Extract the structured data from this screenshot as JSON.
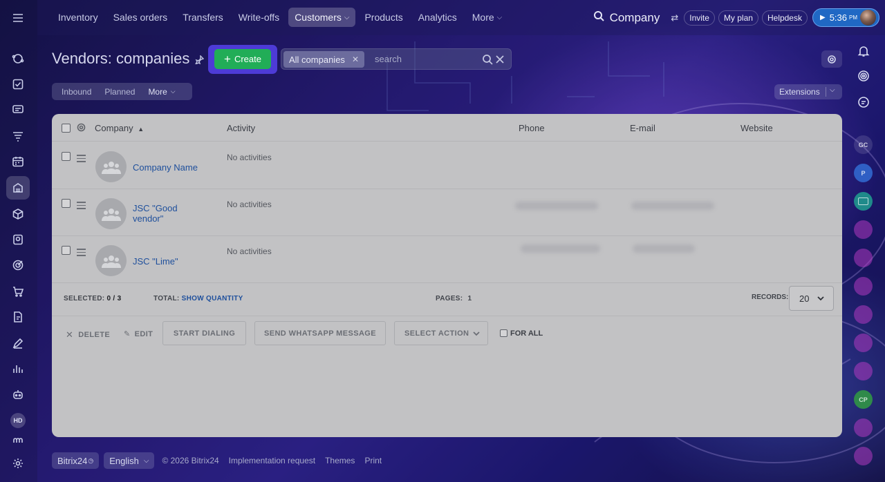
{
  "topnav": {
    "items": [
      "Inventory",
      "Sales orders",
      "Transfers",
      "Write-offs",
      "Customers",
      "Products",
      "Analytics",
      "More"
    ],
    "active": "Customers"
  },
  "top_right": {
    "title": "Company",
    "invite": "Invite",
    "my_plan": "My plan",
    "helpdesk": "Helpdesk",
    "time": "5:36",
    "ampm": "PM"
  },
  "page": {
    "title": "Vendors: companies",
    "create_label": "Create"
  },
  "filter": {
    "tag": "All companies",
    "placeholder": "search"
  },
  "subtabs": [
    "Inbound",
    "Planned",
    "More"
  ],
  "extensions_label": "Extensions",
  "grid": {
    "columns": [
      "Company",
      "Activity",
      "Phone",
      "E-mail",
      "Website"
    ],
    "rows": [
      {
        "name": "Company Name",
        "activity": "No activities"
      },
      {
        "name": "JSC \"Good vendor\"",
        "activity": "No activities"
      },
      {
        "name": "JSC \"Lime\"",
        "activity": "No activities"
      }
    ]
  },
  "summary": {
    "selected_label": "SELECTED:",
    "selected_value": "0 / 3",
    "total_label": "TOTAL:",
    "total_link": "SHOW QUANTITY",
    "pages_label": "PAGES:",
    "pages_value": "1",
    "records_label": "RECORDS:",
    "records_value": "20"
  },
  "actions": {
    "delete": "DELETE",
    "edit": "EDIT",
    "start_dialing": "START DIALING",
    "send_whatsapp": "SEND WHATSAPP MESSAGE",
    "select_action": "SELECT ACTION",
    "for_all": "FOR ALL"
  },
  "right_rail": {
    "avatars": [
      "GC",
      "P",
      "",
      "",
      "",
      "",
      "",
      "",
      "",
      "CP",
      "",
      ""
    ]
  },
  "sidebar": {
    "hd_badge": "HD"
  },
  "footer": {
    "brand": "Bitrix24",
    "language": "English",
    "copyright": "© 2026 Bitrix24",
    "implementation": "Implementation request",
    "themes": "Themes",
    "print": "Print"
  },
  "colors": {
    "create_green": "#21ad57",
    "link_blue": "#1e4f9c",
    "time_blue": "#2068c4",
    "highlight_purple": "#4d3bd6"
  }
}
